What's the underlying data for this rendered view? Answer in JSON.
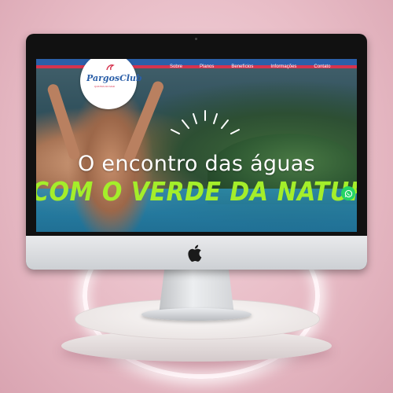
{
  "site": {
    "logo": {
      "name": "PargosClub",
      "tagline": "QUINTAS DO MAR"
    },
    "nav": {
      "items": [
        {
          "label": "Sobre"
        },
        {
          "label": "Planos"
        },
        {
          "label": "Benefícios"
        },
        {
          "label": "Informações"
        },
        {
          "label": "Contato"
        }
      ]
    },
    "hero": {
      "title": "O encontro das águas",
      "subtitle": "COM O VERDE DA NATUREZA"
    },
    "whatsapp_icon": "whatsapp-icon"
  },
  "colors": {
    "stripe_blue": "#2b5fa8",
    "stripe_red": "#d6334e",
    "subtitle_green": "#a4ee2a",
    "background_pink": "#e8bcc6"
  }
}
